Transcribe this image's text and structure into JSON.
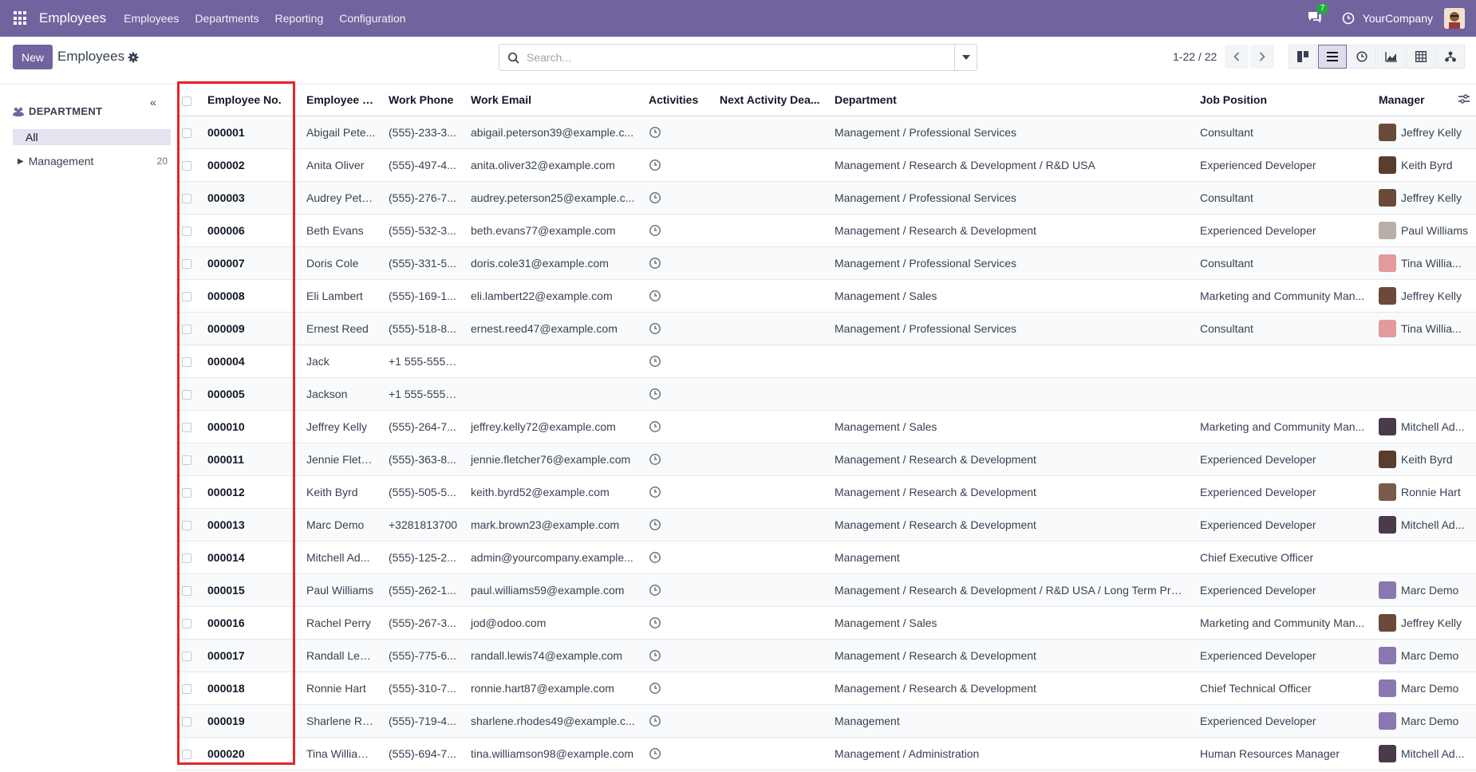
{
  "navbar": {
    "app_name": "Employees",
    "menu": [
      "Employees",
      "Departments",
      "Reporting",
      "Configuration"
    ],
    "message_count": "7",
    "company": "YourCompany",
    "color": "#71639e"
  },
  "control": {
    "new_label": "New",
    "title": "Employees",
    "search_placeholder": "Search...",
    "pager": "1-22 / 22",
    "views": [
      "kanban-view-icon",
      "list-view-icon",
      "activity-view-icon",
      "graph-view-icon",
      "pivot-view-icon",
      "hierarchy-view-icon"
    ],
    "active_view": "list-view-icon"
  },
  "sidebar": {
    "collapse_glyph": "«",
    "header": "DEPARTMENT",
    "all_label": "All",
    "items": [
      {
        "label": "Management",
        "count": "20"
      }
    ]
  },
  "table": {
    "columns": [
      "Employee No.",
      "Employee N...",
      "Work Phone",
      "Work Email",
      "Activities",
      "Next Activity Dea...",
      "Department",
      "Job Position",
      "Manager"
    ],
    "rows": [
      {
        "no": "000001",
        "name": "Abigail Pete...",
        "phone": "(555)-233-3...",
        "email": "abigail.peterson39@example.c...",
        "dept": "Management / Professional Services",
        "job": "Consultant",
        "manager": "Jeffrey Kelly",
        "mgr_color": "#6b4a3a"
      },
      {
        "no": "000002",
        "name": "Anita Oliver",
        "phone": "(555)-497-4...",
        "email": "anita.oliver32@example.com",
        "dept": "Management / Research & Development / R&D USA",
        "job": "Experienced Developer",
        "manager": "Keith Byrd",
        "mgr_color": "#5a3d2e"
      },
      {
        "no": "000003",
        "name": "Audrey Pete...",
        "phone": "(555)-276-7...",
        "email": "audrey.peterson25@example.c...",
        "dept": "Management / Professional Services",
        "job": "Consultant",
        "manager": "Jeffrey Kelly",
        "mgr_color": "#6b4a3a"
      },
      {
        "no": "000006",
        "name": "Beth Evans",
        "phone": "(555)-532-3...",
        "email": "beth.evans77@example.com",
        "dept": "Management / Research & Development",
        "job": "Experienced Developer",
        "manager": "Paul Williams",
        "mgr_color": "#b8b0a8"
      },
      {
        "no": "000007",
        "name": "Doris Cole",
        "phone": "(555)-331-5...",
        "email": "doris.cole31@example.com",
        "dept": "Management / Professional Services",
        "job": "Consultant",
        "manager": "Tina Willia...",
        "mgr_color": "#e29a9a"
      },
      {
        "no": "000008",
        "name": "Eli Lambert",
        "phone": "(555)-169-1...",
        "email": "eli.lambert22@example.com",
        "dept": "Management / Sales",
        "job": "Marketing and Community Man...",
        "manager": "Jeffrey Kelly",
        "mgr_color": "#6b4a3a"
      },
      {
        "no": "000009",
        "name": "Ernest Reed",
        "phone": "(555)-518-8...",
        "email": "ernest.reed47@example.com",
        "dept": "Management / Professional Services",
        "job": "Consultant",
        "manager": "Tina Willia...",
        "mgr_color": "#e29a9a"
      },
      {
        "no": "000004",
        "name": "Jack",
        "phone": "+1 555-555-...",
        "email": "",
        "dept": "",
        "job": "",
        "manager": "",
        "mgr_color": ""
      },
      {
        "no": "000005",
        "name": "Jackson",
        "phone": "+1 555-555-...",
        "email": "",
        "dept": "",
        "job": "",
        "manager": "",
        "mgr_color": ""
      },
      {
        "no": "000010",
        "name": "Jeffrey Kelly",
        "phone": "(555)-264-7...",
        "email": "jeffrey.kelly72@example.com",
        "dept": "Management / Sales",
        "job": "Marketing and Community Man...",
        "manager": "Mitchell Ad...",
        "mgr_color": "#4a3a4a"
      },
      {
        "no": "000011",
        "name": "Jennie Fletc...",
        "phone": "(555)-363-8...",
        "email": "jennie.fletcher76@example.com",
        "dept": "Management / Research & Development",
        "job": "Experienced Developer",
        "manager": "Keith Byrd",
        "mgr_color": "#5a3d2e"
      },
      {
        "no": "000012",
        "name": "Keith Byrd",
        "phone": "(555)-505-5...",
        "email": "keith.byrd52@example.com",
        "dept": "Management / Research & Development",
        "job": "Experienced Developer",
        "manager": "Ronnie Hart",
        "mgr_color": "#7a5a48"
      },
      {
        "no": "000013",
        "name": "Marc Demo",
        "phone": "+3281813700",
        "email": "mark.brown23@example.com",
        "dept": "Management / Research & Development",
        "job": "Experienced Developer",
        "manager": "Mitchell Ad...",
        "mgr_color": "#4a3a4a"
      },
      {
        "no": "000014",
        "name": "Mitchell Ad...",
        "phone": "(555)-125-2...",
        "email": "admin@yourcompany.example...",
        "dept": "Management",
        "job": "Chief Executive Officer",
        "manager": "",
        "mgr_color": ""
      },
      {
        "no": "000015",
        "name": "Paul Williams",
        "phone": "(555)-262-1...",
        "email": "paul.williams59@example.com",
        "dept": "Management / Research & Development / R&D USA / Long Term Proj...",
        "job": "Experienced Developer",
        "manager": "Marc Demo",
        "mgr_color": "#8a78b0"
      },
      {
        "no": "000016",
        "name": "Rachel Perry",
        "phone": "(555)-267-3...",
        "email": "jod@odoo.com",
        "dept": "Management / Sales",
        "job": "Marketing and Community Man...",
        "manager": "Jeffrey Kelly",
        "mgr_color": "#6b4a3a"
      },
      {
        "no": "000017",
        "name": "Randall Lewis",
        "phone": "(555)-775-6...",
        "email": "randall.lewis74@example.com",
        "dept": "Management / Research & Development",
        "job": "Experienced Developer",
        "manager": "Marc Demo",
        "mgr_color": "#8a78b0"
      },
      {
        "no": "000018",
        "name": "Ronnie Hart",
        "phone": "(555)-310-7...",
        "email": "ronnie.hart87@example.com",
        "dept": "Management / Research & Development",
        "job": "Chief Technical Officer",
        "manager": "Marc Demo",
        "mgr_color": "#8a78b0"
      },
      {
        "no": "000019",
        "name": "Sharlene Rh...",
        "phone": "(555)-719-4...",
        "email": "sharlene.rhodes49@example.c...",
        "dept": "Management",
        "job": "Experienced Developer",
        "manager": "Marc Demo",
        "mgr_color": "#8a78b0"
      },
      {
        "no": "000020",
        "name": "Tina William...",
        "phone": "(555)-694-7...",
        "email": "tina.williamson98@example.com",
        "dept": "Management / Administration",
        "job": "Human Resources Manager",
        "manager": "Mitchell Ad...",
        "mgr_color": "#4a3a4a"
      }
    ]
  }
}
